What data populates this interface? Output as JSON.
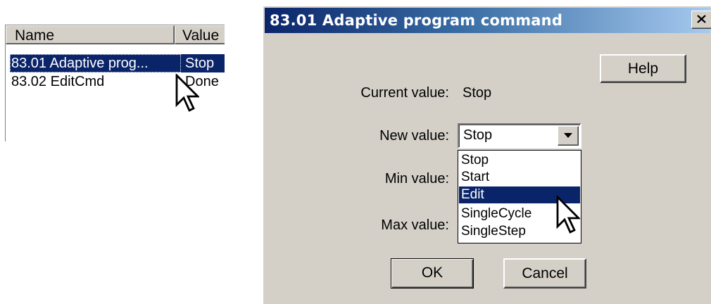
{
  "list_view": {
    "columns": [
      "Name",
      "Value"
    ],
    "rows": [
      {
        "name": "83.01 Adaptive prog...",
        "value": "Stop"
      },
      {
        "name": "83.02 EditCmd",
        "value": "Done"
      }
    ]
  },
  "dialog": {
    "title": "83.01 Adaptive program command",
    "help_label": "Help",
    "current_value_label": "Current value:",
    "current_value": "Stop",
    "new_value_label": "New value:",
    "new_value": "Stop",
    "min_value_label": "Min value:",
    "max_value_label": "Max value:",
    "dropdown_options": [
      "Stop",
      "Start",
      "Edit",
      "SingleCycle",
      "SingleStep"
    ],
    "highlighted_option": "Edit",
    "ok_label": "OK",
    "cancel_label": "Cancel"
  },
  "colors": {
    "selection": "#0a246a",
    "dialog_face": "#d4d0c8",
    "title_gradient_start": "#0a246a",
    "title_gradient_end": "#a6caf0"
  },
  "icons": [
    "arrow-cursor-icon",
    "close-icon",
    "dropdown-arrow-icon"
  ]
}
